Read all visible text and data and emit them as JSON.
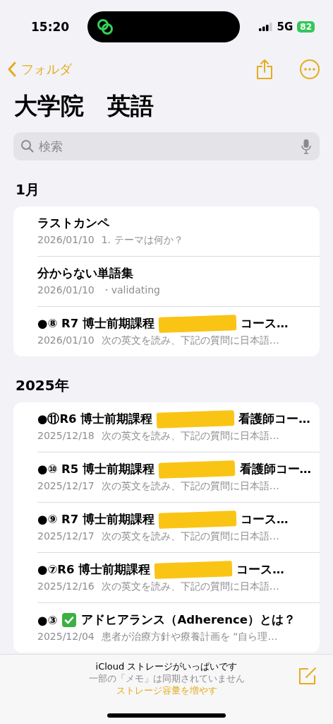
{
  "status_bar": {
    "time": "15:20",
    "network": "5G",
    "battery": "82"
  },
  "nav": {
    "back_label": "フォルダ"
  },
  "title": "大学院　英語",
  "search": {
    "placeholder": "検索"
  },
  "sections": [
    {
      "header": "1月",
      "notes": [
        {
          "title": "ラストカンペ",
          "redacted": false,
          "checkmark": false,
          "date": "2026/01/10",
          "preview": "1. テーマは何か？"
        },
        {
          "title": "分からない単語集",
          "redacted": false,
          "checkmark": false,
          "date": "2026/01/10",
          "preview": "・validating"
        },
        {
          "title": "●⑧ R7 博士前期課程",
          "redacted": true,
          "checkmark": false,
          "title_end": "コース…",
          "date": "2026/01/10",
          "preview": "次の英文を読み、下記の質問に日本語…"
        }
      ]
    },
    {
      "header": "2025年",
      "notes": [
        {
          "title": "●⑪R6 博士前期課程",
          "redacted": true,
          "checkmark": false,
          "title_end": "看護師コー…",
          "date": "2025/12/18",
          "preview": "次の英文を読み、下記の質問に日本語…"
        },
        {
          "title": "●⑩ R5 博士前期課程",
          "redacted": true,
          "checkmark": false,
          "title_end": "看護師コー…",
          "date": "2025/12/17",
          "preview": "次の英文を読み、下記の質問に日本語…"
        },
        {
          "title": "●⑨ R7 博士前期課程",
          "redacted": true,
          "checkmark": false,
          "title_end": "コース…",
          "date": "2025/12/17",
          "preview": "次の英文を読み、下記の質問に日本語…"
        },
        {
          "title": "●⑦R6 博士前期課程",
          "redacted": true,
          "checkmark": false,
          "title_end": "コース…",
          "date": "2025/12/16",
          "preview": "次の英文を読み、下記の質問に日本語…"
        },
        {
          "title": "●③",
          "redacted": false,
          "checkmark": true,
          "title_end": "アドヒアランス（Adherence）とは？",
          "date": "2025/12/04",
          "preview": "患者が治療方針や療養計画を “自ら理…"
        }
      ]
    }
  ],
  "toolbar": {
    "message": "iCloud ストレージがいっぱいです",
    "detail": "一部の「メモ」は同期されていません",
    "link": "ストレージ容量を増やす"
  }
}
